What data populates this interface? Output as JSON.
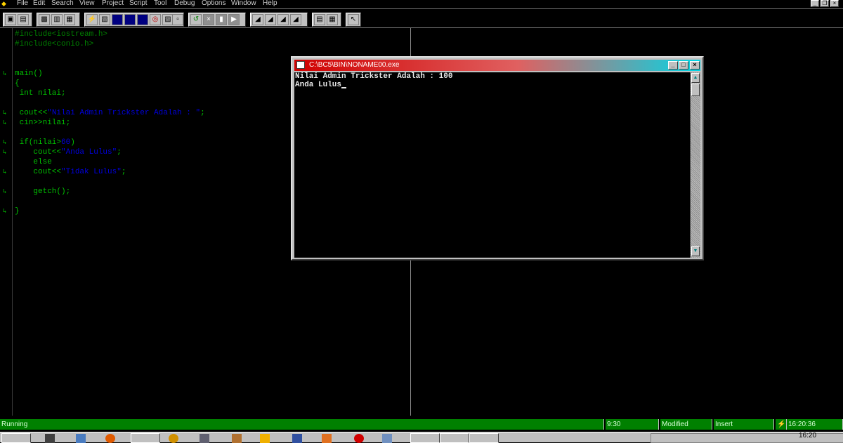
{
  "menubar": {
    "items": [
      "File",
      "Edit",
      "Search",
      "View",
      "Project",
      "Script",
      "Tool",
      "Debug",
      "Options",
      "Window",
      "Help"
    ]
  },
  "editor": {
    "lines": [
      {
        "text": "#include<iostream.h>",
        "kind": "include",
        "mark": false
      },
      {
        "text": "#include<conio.h>",
        "kind": "include",
        "mark": false
      },
      {
        "text": "main()",
        "kind": "code",
        "mark": true
      },
      {
        "text": "{",
        "kind": "code",
        "mark": false
      },
      {
        "text": " int nilai;",
        "kind": "code",
        "mark": false
      },
      {
        "text": " cout<<",
        "string": "\"Nilai Admin Trickster Adalah : \"",
        "tail": ";",
        "kind": "code",
        "mark": true
      },
      {
        "text": " cin>>nilai;",
        "kind": "code",
        "mark": true
      },
      {
        "text": " if(nilai>",
        "number": "60",
        "tail": ")",
        "kind": "code",
        "mark": true
      },
      {
        "text": "    cout<<",
        "string": "\"Anda Lulus\"",
        "tail": ";",
        "kind": "code",
        "mark": true
      },
      {
        "text": "    else",
        "kind": "code",
        "mark": false
      },
      {
        "text": "    cout<<",
        "string": "\"Tidak Lulus\"",
        "tail": ";",
        "kind": "code",
        "mark": true
      },
      {
        "text": "    getch();",
        "kind": "code",
        "mark": true
      },
      {
        "text": "}",
        "kind": "code",
        "mark": true
      }
    ]
  },
  "console": {
    "title": "C:\\BC5\\BIN\\NONAME00.exe",
    "output": [
      "Nilai Admin Trickster Adalah : 100",
      "Anda Lulus"
    ]
  },
  "statusbar": {
    "state": "Running",
    "position": "9:30",
    "modified": "Modified",
    "mode": "Insert",
    "time": "16:20:36"
  },
  "taskbar": {
    "clock": "16:20"
  }
}
